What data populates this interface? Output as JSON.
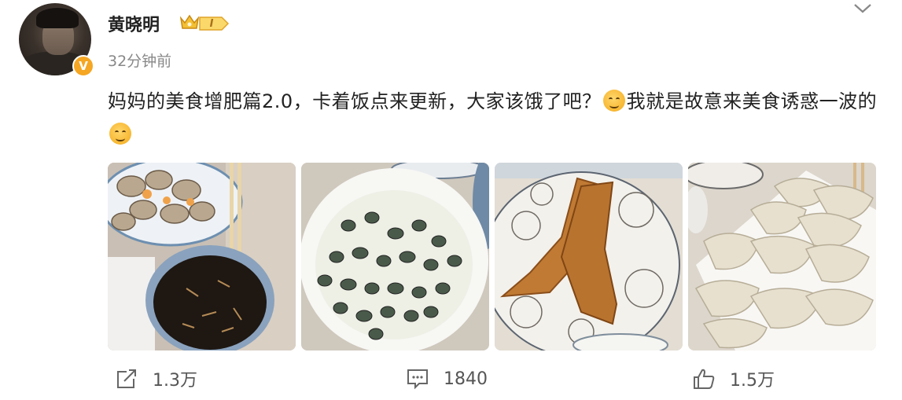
{
  "post": {
    "username": "黄晓明",
    "level_badge": "I",
    "timestamp": "32分钟前",
    "text_part1": "妈妈的美食增肥篇2.0，卡着饭点来更新，大家该饿了吧？",
    "text_part2": "我就是故意来美食诱惑一波的",
    "emoji_1": "yum-face-icon",
    "emoji_2": "smirk-face-icon",
    "verified_mark": "V"
  },
  "photos": [
    {
      "name": "clams-and-dipping-sauce-photo"
    },
    {
      "name": "sea-snails-plate-photo"
    },
    {
      "name": "fried-fish-plate-photo"
    },
    {
      "name": "dumplings-plate-photo"
    }
  ],
  "actions": {
    "forward_count": "1.3万",
    "comment_count": "1840",
    "like_count": "1.5万"
  },
  "colors": {
    "accent_badge": "#f5a623",
    "text_primary": "#222222",
    "text_secondary": "#888888"
  }
}
